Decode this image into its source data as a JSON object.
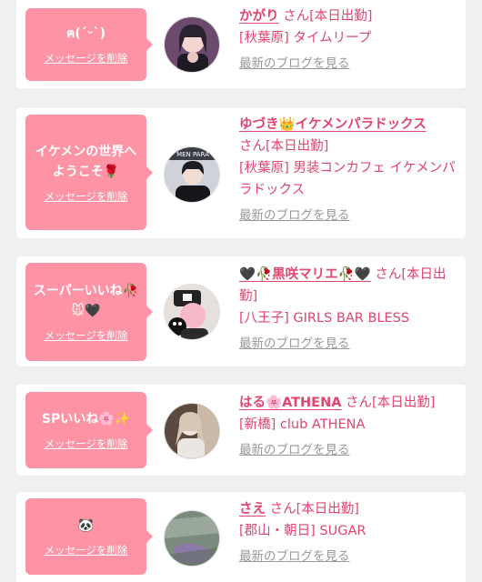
{
  "delete_label": "メッセージを削除",
  "blog_label": "最新のブログを見る",
  "colors": {
    "bubble": "#fd93a4",
    "name": "#e0456e",
    "blog": "#999999"
  },
  "cards": [
    {
      "message": "ฅ(ˊᵕˋ)",
      "name": "かがり",
      "suffix": " さん[本日出勤]",
      "shop": "[秋葉原] タイムリープ"
    },
    {
      "message": "イケメンの世界へようこそ🌹",
      "name_parts": [
        "ゆづき",
        "👑",
        "イケメンパラドックス"
      ],
      "suffix": "さん[本日出勤]",
      "shop": "[秋葉原] 男装コンカフェ イケメンパラドックス"
    },
    {
      "message": "スーパーいいね🥀🐭🖤",
      "name_parts": [
        "🖤🥀",
        "黒咲マリエ",
        "🥀🖤"
      ],
      "suffix": " さん[本日出勤]",
      "shop": "[八王子] GIRLS BAR BLESS"
    },
    {
      "message": "SPいいね🌸✨",
      "name_parts": [
        "はる",
        "🌸",
        "ATHENA"
      ],
      "suffix": " さん[本日出勤]",
      "shop": "[新橋] club ATHENA"
    },
    {
      "message": "🐼",
      "name": "さえ",
      "suffix": " さん[本日出勤]",
      "shop": "[郡山・朝日] SUGAR"
    }
  ]
}
